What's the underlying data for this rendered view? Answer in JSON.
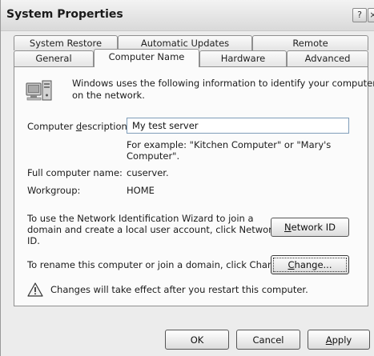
{
  "window": {
    "title": "System Properties",
    "help_button": "?",
    "close_button": "×"
  },
  "tabs": {
    "row1": [
      "System Restore",
      "Automatic Updates",
      "Remote"
    ],
    "row2": [
      "General",
      "Computer Name",
      "Hardware",
      "Advanced"
    ],
    "active": "Computer Name"
  },
  "computer_name_tab": {
    "intro_line1": "Windows uses the following information to identify your computer",
    "intro_line2": "on the network.",
    "description_label_pre": "Computer ",
    "description_label_ul": "d",
    "description_label_post": "escription:",
    "description_value": "My test server",
    "example_line1": "For example: \"Kitchen Computer\" or \"Mary's",
    "example_line2": "Computer\".",
    "full_name_label": "Full computer name:",
    "full_name_value": "cuserver.",
    "workgroup_label": "Workgroup:",
    "workgroup_value": "HOME",
    "network_id_text_line1": "To use the Network Identification Wizard to join a",
    "network_id_text_line2": "domain and create a local user account, click Network",
    "network_id_text_line3": "ID.",
    "network_id_button_ul": "N",
    "network_id_button_rest": "etwork ID",
    "rename_text": "To rename this computer or join a domain, click Change.",
    "change_button_ul": "C",
    "change_button_rest": "hange...",
    "warning_text": "Changes will take effect after you restart this computer."
  },
  "footer": {
    "ok_label": "OK",
    "cancel_label": "Cancel",
    "apply_ul": "A",
    "apply_rest": "pply"
  },
  "colors": {
    "input_border": "#7f9db9",
    "panel_bg": "#fbfbfb",
    "dialog_bg": "#ececec"
  },
  "icons": [
    "computer-icon",
    "warning-icon",
    "help-icon",
    "close-icon"
  ]
}
